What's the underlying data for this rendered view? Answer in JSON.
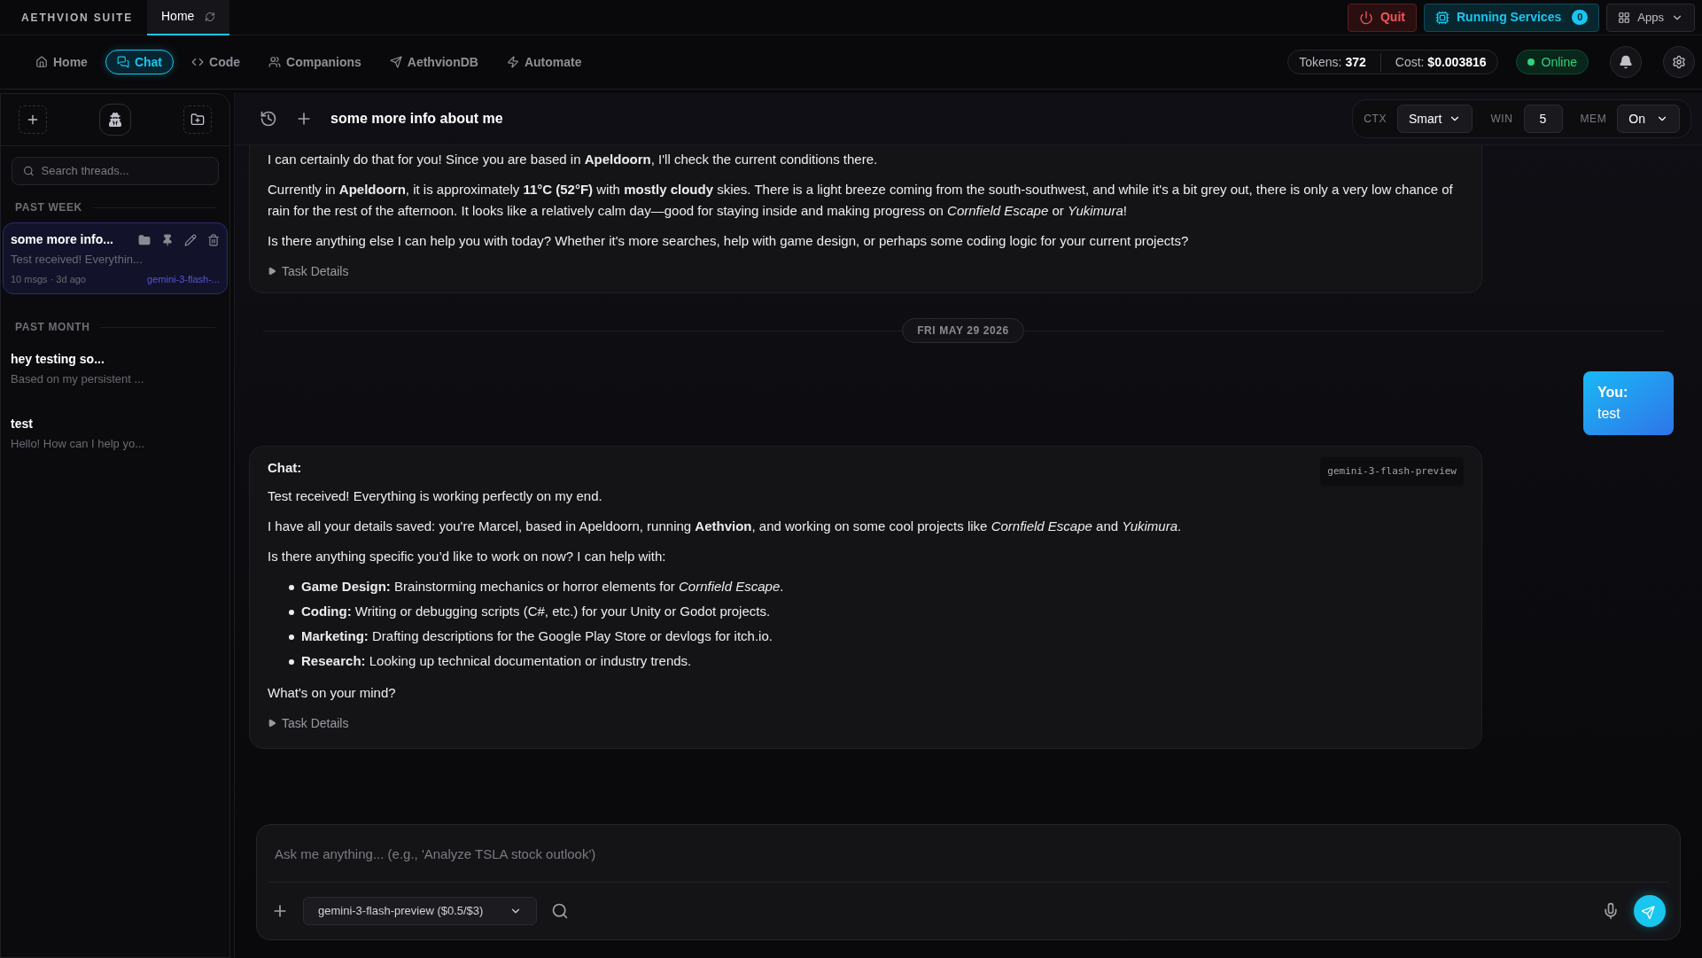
{
  "brand": "AETHVION SUITE",
  "window_tabs": [
    {
      "label": "Home",
      "selected": true
    }
  ],
  "top_actions": {
    "quit": "Quit",
    "services": "Running Services",
    "services_count": "0",
    "apps": "Apps"
  },
  "nav": [
    {
      "label": "Home",
      "selected": false
    },
    {
      "label": "Chat",
      "selected": true
    },
    {
      "label": "Code",
      "selected": false
    },
    {
      "label": "Companions",
      "selected": false
    },
    {
      "label": "AethvionDB",
      "selected": false
    },
    {
      "label": "Automate",
      "selected": false
    }
  ],
  "stats": {
    "tokens_label": "Tokens:",
    "tokens": "372",
    "cost_label": "Cost:",
    "cost": "$0.003816",
    "status": "Online"
  },
  "sidebar": {
    "search_placeholder": "Search threads...",
    "groups": [
      {
        "title": "PAST WEEK",
        "threads": [
          {
            "title": "some more info...",
            "preview": "Test received! Everythin...",
            "meta": "10 msgs · 3d ago",
            "model": "gemini-3-flash-...",
            "selected": true
          }
        ]
      },
      {
        "title": "PAST MONTH",
        "threads": [
          {
            "title": "hey testing so...",
            "preview": "Based on my persistent ...",
            "selected": false
          },
          {
            "title": "test",
            "preview": "Hello! How can I help yo...",
            "selected": false
          }
        ]
      }
    ]
  },
  "chat_header": {
    "title": "some more info about me",
    "ctx_label": "CTX",
    "ctx": "Smart",
    "win_label": "WIN",
    "win": "5",
    "mem_label": "MEM",
    "mem": "On"
  },
  "messages": [
    {
      "kind": "assistant",
      "blocks": [
        {
          "kind": "p",
          "text": "I can certainly do that for you! Since you are based in **Apeldoorn**, I'll check the current conditions there."
        },
        {
          "kind": "p",
          "text": "Currently in **Apeldoorn**, it is approximately **11°C (52°F)** with **mostly cloudy** skies. There is a light breeze coming from the south-southwest, and while it's a bit grey out, there is only a very low chance of rain for the rest of the afternoon. It looks like a relatively calm day—good for staying inside and making progress on *Cornfield Escape* or *Yukimura*!"
        },
        {
          "kind": "p",
          "text": "Is there anything else I can help you with today? Whether it's more searches, help with game design, or perhaps some coding logic for your current projects?"
        }
      ],
      "details": "Task Details"
    },
    {
      "kind": "date",
      "text": "FRI MAY 29 2026"
    },
    {
      "kind": "user",
      "label": "You:",
      "text": "test"
    },
    {
      "kind": "assistant",
      "label": "Chat:",
      "model": "gemini-3-flash-preview",
      "blocks": [
        {
          "kind": "p",
          "text": "Test received! Everything is working perfectly on my end."
        },
        {
          "kind": "p",
          "text": "I have all your details saved: you're Marcel, based in Apeldoorn, running **Aethvion**, and working on some cool projects like *Cornfield Escape* and *Yukimura*."
        },
        {
          "kind": "p",
          "text": "Is there anything specific you’d like to work on now? I can help with:"
        },
        {
          "kind": "list",
          "items": [
            "**Game Design:** Brainstorming mechanics or horror elements for *Cornfield Escape*.",
            "**Coding:** Writing or debugging scripts (C#, etc.) for your Unity or Godot projects.",
            "**Marketing:** Drafting descriptions for the Google Play Store or devlogs for itch.io.",
            "**Research:** Looking up technical documentation or industry trends."
          ]
        },
        {
          "kind": "p",
          "text": "What's on your mind?"
        }
      ],
      "details": "Task Details"
    }
  ],
  "composer": {
    "placeholder": "Ask me anything... (e.g., 'Analyze TSLA stock outlook')",
    "model": "gemini-3-flash-preview ($0.5/$3)"
  }
}
